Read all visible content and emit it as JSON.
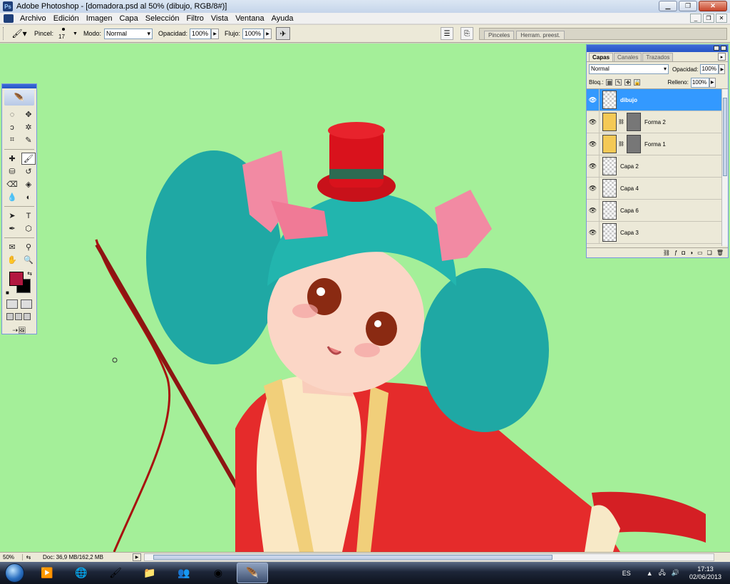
{
  "window": {
    "title": "Adobe Photoshop - [domadora.psd al 50% (dibujo, RGB/8#)]",
    "app_icon": "photoshop-icon"
  },
  "menu": {
    "items": [
      "Archivo",
      "Edición",
      "Imagen",
      "Capa",
      "Selección",
      "Filtro",
      "Vista",
      "Ventana",
      "Ayuda"
    ]
  },
  "options": {
    "brush_label": "Pincel:",
    "brush_size": "17",
    "mode_label": "Modo:",
    "mode_value": "Normal",
    "opacity_label": "Opacidad:",
    "opacity_value": "100%",
    "flow_label": "Flujo:",
    "flow_value": "100%",
    "palette_tabs": [
      "Pinceles",
      "Herram. preest."
    ]
  },
  "toolbox": {
    "foreground_color": "#b2173f",
    "background_color": "#000000",
    "tools": [
      "marquee-icon",
      "move-icon",
      "lasso-icon",
      "magic-wand-icon",
      "crop-icon",
      "slice-icon",
      "healing-icon",
      "brush-icon",
      "stamp-icon",
      "history-brush-icon",
      "eraser-icon",
      "paint-bucket-icon",
      "blur-icon",
      "dodge-icon",
      "path-select-icon",
      "type-icon",
      "pen-icon",
      "shape-icon",
      "notes-icon",
      "eyedropper-icon",
      "hand-icon",
      "zoom-icon"
    ]
  },
  "layers_panel": {
    "tabs": [
      "Capas",
      "Canales",
      "Trazados"
    ],
    "blend_mode": "Normal",
    "opacity_label": "Opacidad:",
    "opacity_value": "100%",
    "lock_label": "Bloq.:",
    "fill_label": "Relleno:",
    "fill_value": "100%",
    "layers": [
      {
        "name": "dibujo",
        "selected": true,
        "type": "pixel"
      },
      {
        "name": "Forma 2",
        "selected": false,
        "type": "shape"
      },
      {
        "name": "Forma 1",
        "selected": false,
        "type": "shape"
      },
      {
        "name": "Capa 2",
        "selected": false,
        "type": "pixel"
      },
      {
        "name": "Capa 4",
        "selected": false,
        "type": "pixel"
      },
      {
        "name": "Capa 6",
        "selected": false,
        "type": "pixel"
      },
      {
        "name": "Capa 3",
        "selected": false,
        "type": "pixel"
      }
    ]
  },
  "canvas": {
    "background_color": "#a4ef99"
  },
  "status": {
    "zoom": "50%",
    "doc": "Doc: 36,9 MB/162,2 MB"
  },
  "taskbar": {
    "lang": "ES",
    "time": "17:13",
    "date": "02/06/2013"
  }
}
